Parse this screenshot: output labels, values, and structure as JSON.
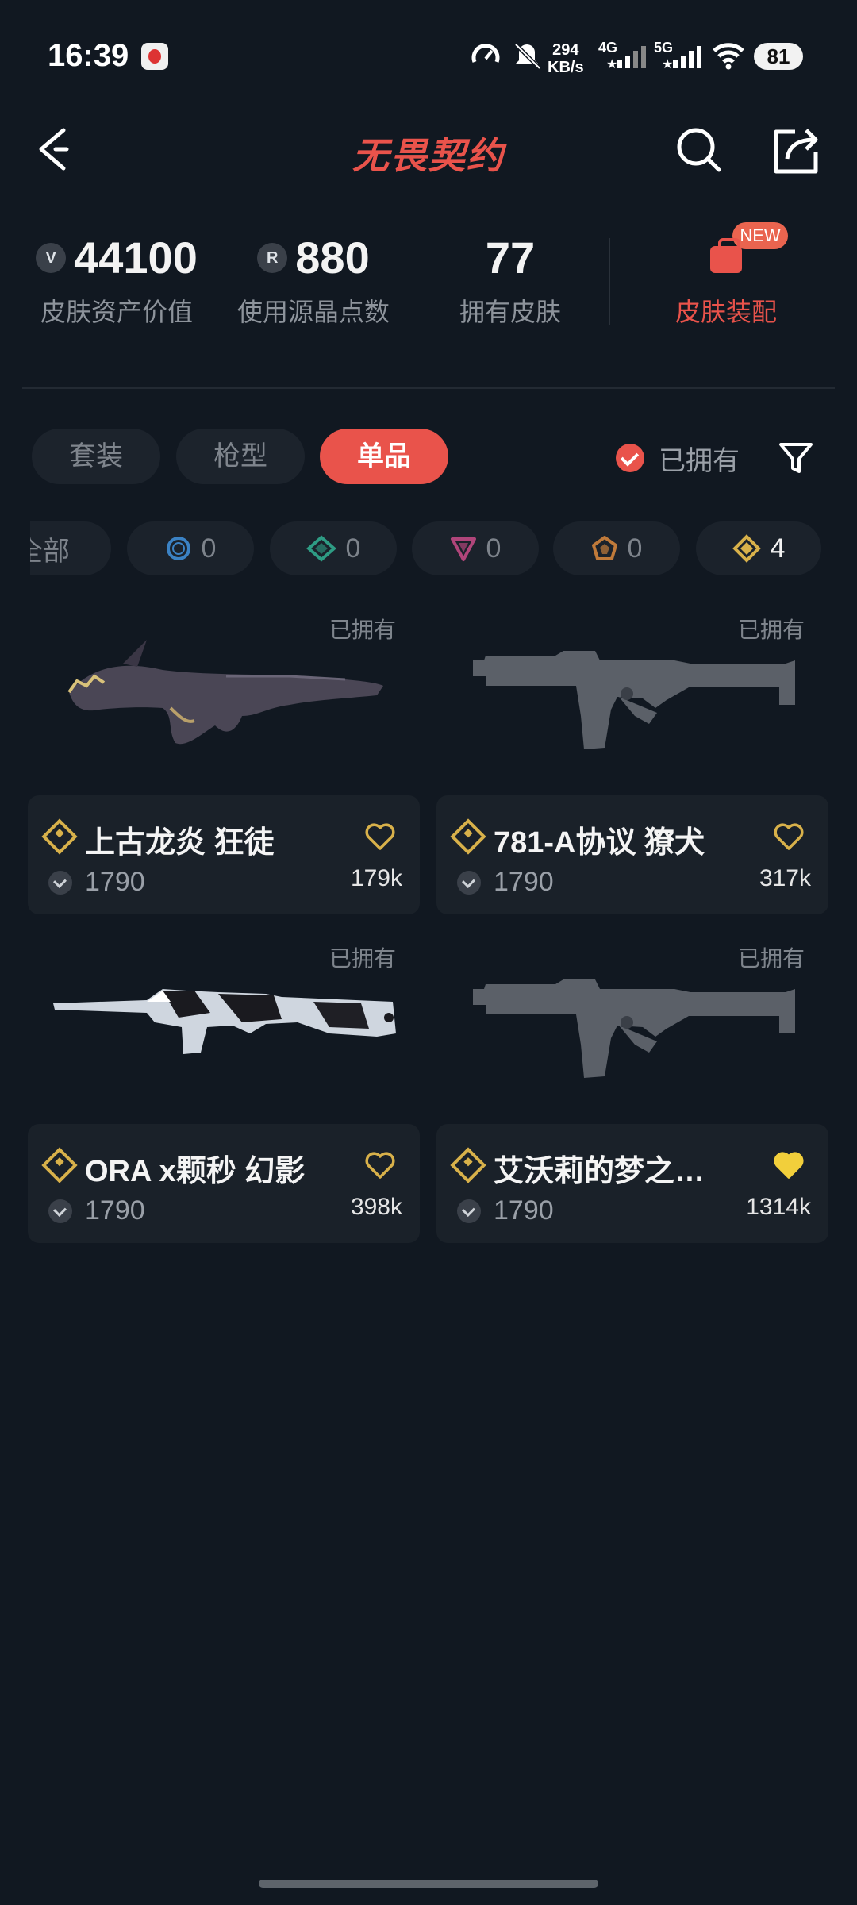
{
  "status_bar": {
    "time": "16:39",
    "net_speed_value": "294",
    "net_speed_unit": "KB/s",
    "signal_1": "4G",
    "signal_2": "5G",
    "battery": "81"
  },
  "header": {
    "logo_text": "无畏契约"
  },
  "stats": [
    {
      "value": "44100",
      "label": "皮肤资产价值",
      "icon": "vp-coin-icon"
    },
    {
      "value": "880",
      "label": "使用源晶点数",
      "icon": "radianite-icon"
    },
    {
      "value": "77",
      "label": "拥有皮肤"
    }
  ],
  "equip": {
    "label": "皮肤装配",
    "badge": "NEW"
  },
  "tabs": [
    {
      "label": "套装",
      "active": false
    },
    {
      "label": "枪型",
      "active": false
    },
    {
      "label": "单品",
      "active": true
    }
  ],
  "owned_filter": {
    "label": "已拥有",
    "checked": true
  },
  "rarity_filters": [
    {
      "label": "全部",
      "count": ""
    },
    {
      "label": "select-tier",
      "count": "0",
      "color": "#3b82c4"
    },
    {
      "label": "deluxe-tier",
      "count": "0",
      "color": "#2e9c84"
    },
    {
      "label": "premium-tier",
      "count": "0",
      "color": "#b0457a"
    },
    {
      "label": "ultra-tier",
      "count": "0",
      "color": "#c07a3a"
    },
    {
      "label": "exclusive-tier",
      "count": "4",
      "color": "#d8b14a"
    }
  ],
  "cards": [
    {
      "owned": "已拥有",
      "title": "上古龙炎 狂徒",
      "price": "1790",
      "likes": "179k",
      "liked": false
    },
    {
      "owned": "已拥有",
      "title": "781-A协议 獠犬",
      "price": "1790",
      "likes": "317k",
      "liked": false
    },
    {
      "owned": "已拥有",
      "title": "ORA x颗秒 幻影",
      "price": "1790",
      "likes": "398k",
      "liked": false
    },
    {
      "owned": "已拥有",
      "title": "艾沃莉的梦之…",
      "price": "1790",
      "likes": "1314k",
      "liked": true
    }
  ],
  "colors": {
    "accent": "#e9534b",
    "gold": "#d8b14a",
    "background": "#111821"
  }
}
